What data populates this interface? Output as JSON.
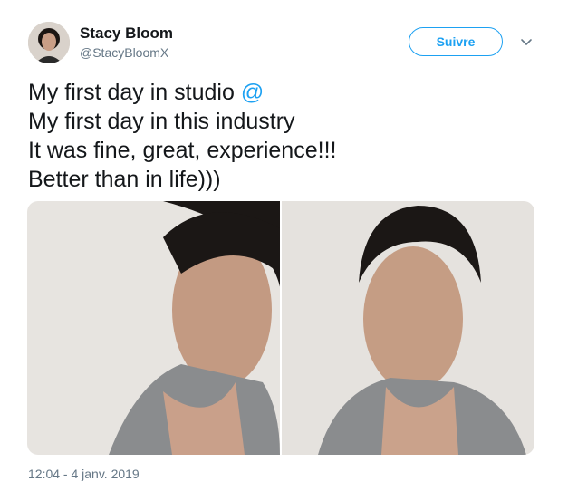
{
  "author": {
    "name": "Stacy Bloom",
    "handle": "@StacyBloomX"
  },
  "follow_button_label": "Suivre",
  "tweet": {
    "line1_prefix": "My first day in studio ",
    "mention": "@",
    "line2": "My first day in this industry",
    "line3": "It was fine, great, experience!!!",
    "line4": "Better than in life)))"
  },
  "timestamp": "12:04 - 4 janv. 2019",
  "colors": {
    "accent": "#1da1f2",
    "text": "#14171a",
    "secondary": "#657786"
  },
  "icons": [
    "chevron-down-icon"
  ]
}
